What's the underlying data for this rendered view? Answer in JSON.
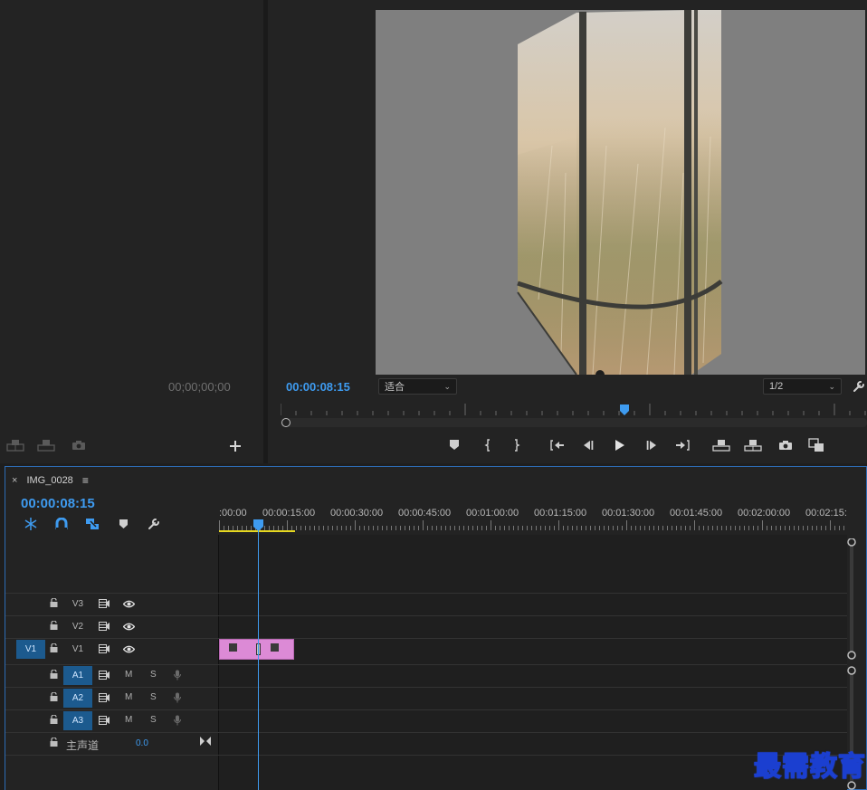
{
  "source_monitor": {
    "timecode": "00;00;00;00",
    "buttons": [
      "insert-icon",
      "overwrite-icon",
      "camera-icon",
      "plus-icon"
    ]
  },
  "program_monitor": {
    "timecode": "00:00:08:15",
    "fit_label": "适合",
    "resolution_label": "1/2",
    "transport_buttons": [
      "marker-icon",
      "mark-in-icon",
      "mark-out-icon",
      "go-to-in-icon",
      "step-back-icon",
      "play-icon",
      "step-forward-icon",
      "go-to-out-icon",
      "lift-icon",
      "extract-icon",
      "camera-icon",
      "compare-icon"
    ]
  },
  "timeline": {
    "tab_close": "×",
    "sequence_name": "IMG_0028",
    "menu_glyph": "≡",
    "timecode": "00:00:08:15",
    "ruler_labels": [
      ":00:00",
      "00:00:15:00",
      "00:00:30:00",
      "00:00:45:00",
      "00:01:00:00",
      "00:01:15:00",
      "00:01:30:00",
      "00:01:45:00",
      "00:02:00:00",
      "00:02:15:"
    ],
    "tracks": [
      {
        "name": "V3",
        "type": "video",
        "targeted": false,
        "source": ""
      },
      {
        "name": "V2",
        "type": "video",
        "targeted": false,
        "source": ""
      },
      {
        "name": "V1",
        "type": "video",
        "targeted": true,
        "source": "V1"
      },
      {
        "name": "A1",
        "type": "audio",
        "targeted": true,
        "source": ""
      },
      {
        "name": "A2",
        "type": "audio",
        "targeted": true,
        "source": ""
      },
      {
        "name": "A3",
        "type": "audio",
        "targeted": true,
        "source": ""
      }
    ],
    "mute_label": "M",
    "solo_label": "S",
    "master": {
      "label": "主声道",
      "value": "0.0"
    }
  },
  "watermark": "最需教育",
  "colors": {
    "accent": "#3e9bf0",
    "clip": "#dc8ad6",
    "track_target": "#1c5a8e",
    "work_area": "#e6d820"
  }
}
